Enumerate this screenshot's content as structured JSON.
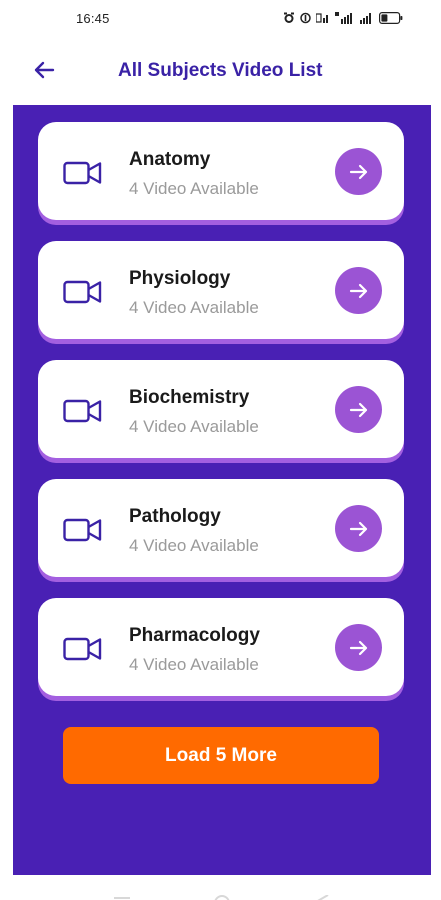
{
  "status_bar": {
    "time": "16:45"
  },
  "header": {
    "title": "All Subjects Video List",
    "back_icon": "arrow-left-icon"
  },
  "colors": {
    "panel": "#4920b4",
    "title": "#3a22a6",
    "arrow_button": "#9b54d4",
    "card_shadow": "#a35fe0",
    "load_more": "#ff6a00"
  },
  "subjects": [
    {
      "name": "Anatomy",
      "count_label": "4 Video Available"
    },
    {
      "name": "Physiology",
      "count_label": "4 Video Available"
    },
    {
      "name": "Biochemistry",
      "count_label": "4 Video Available"
    },
    {
      "name": "Pathology",
      "count_label": "4 Video Available"
    },
    {
      "name": "Pharmacology",
      "count_label": "4 Video Available"
    }
  ],
  "load_more_label": "Load 5 More"
}
